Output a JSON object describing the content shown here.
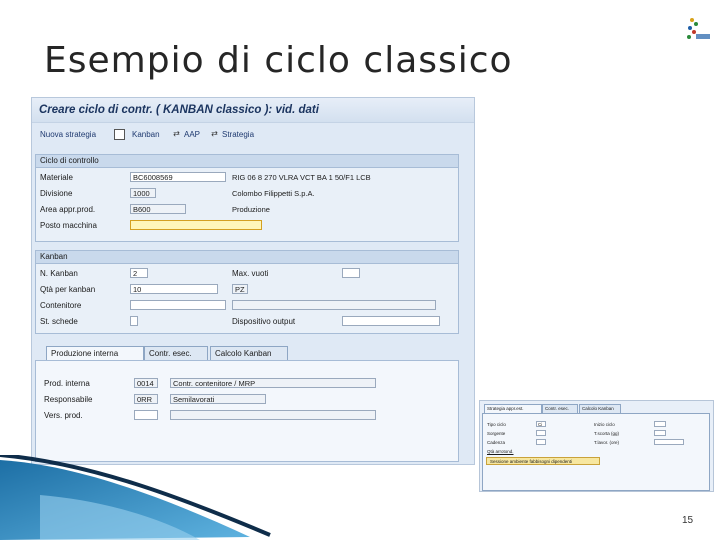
{
  "slide": {
    "title": "Esempio di ciclo classico",
    "page_number": "15"
  },
  "sap": {
    "window_title": "Creare ciclo di contr. ( KANBAN classico ): vid. dati",
    "toolbar": {
      "nuova_strategia": "Nuova strategia",
      "kanban": "Kanban",
      "aap": "AAP",
      "strategia": "Strategia"
    },
    "ciclo": {
      "header": "Ciclo di controllo",
      "materiale_label": "Materiale",
      "materiale_value": "BC6008569",
      "materiale_desc": "RIG 06 8 270 VLRA VCT BA 1 50/F1 LCB",
      "divisione_label": "Divisione",
      "divisione_value": "1000",
      "divisione_desc": "Colombo Filippetti S.p.A.",
      "area_label": "Area appr.prod.",
      "area_value": "B600",
      "area_desc": "Produzione",
      "posto_label": "Posto macchina",
      "posto_value": ""
    },
    "kanban": {
      "header": "Kanban",
      "n_kanban_label": "N. Kanban",
      "n_kanban_value": "2",
      "max_vuoti_label": "Max. vuoti",
      "qta_label": "Qtà per kanban",
      "qta_value": "10",
      "qta_unit": "PZ",
      "contenitore_label": "Contenitore",
      "st_schede_label": "St. schede",
      "dispositivo_label": "Dispositivo output"
    },
    "tabs": [
      "Produzione interna",
      "Contr. esec.",
      "Calcolo Kanban"
    ],
    "produzione": {
      "prod_interna_label": "Prod. interna",
      "prod_interna_value": "0014",
      "prod_interna_desc": "Contr. contenitore / MRP",
      "responsabile_label": "Responsabile",
      "responsabile_value": "0RR",
      "responsabile_desc": "Semilavorati",
      "vers_prod_label": "Vers. prod."
    }
  },
  "mini": {
    "tabs": [
      "Strategia appr.est.",
      "Contr. esec.",
      "Calcolo Kanban"
    ],
    "labels_left": [
      "Tipo ciclo",
      "Sorgente",
      "Cadenza",
      "Qtà arrotond."
    ],
    "labels_right": [
      "Inizio ciclo",
      "T.scorta (gg)",
      "T.lavor. (ore)"
    ],
    "tipo_ciclo_value": "Ci",
    "button": "Sessione ambiente fabbisogni dipendenti"
  }
}
